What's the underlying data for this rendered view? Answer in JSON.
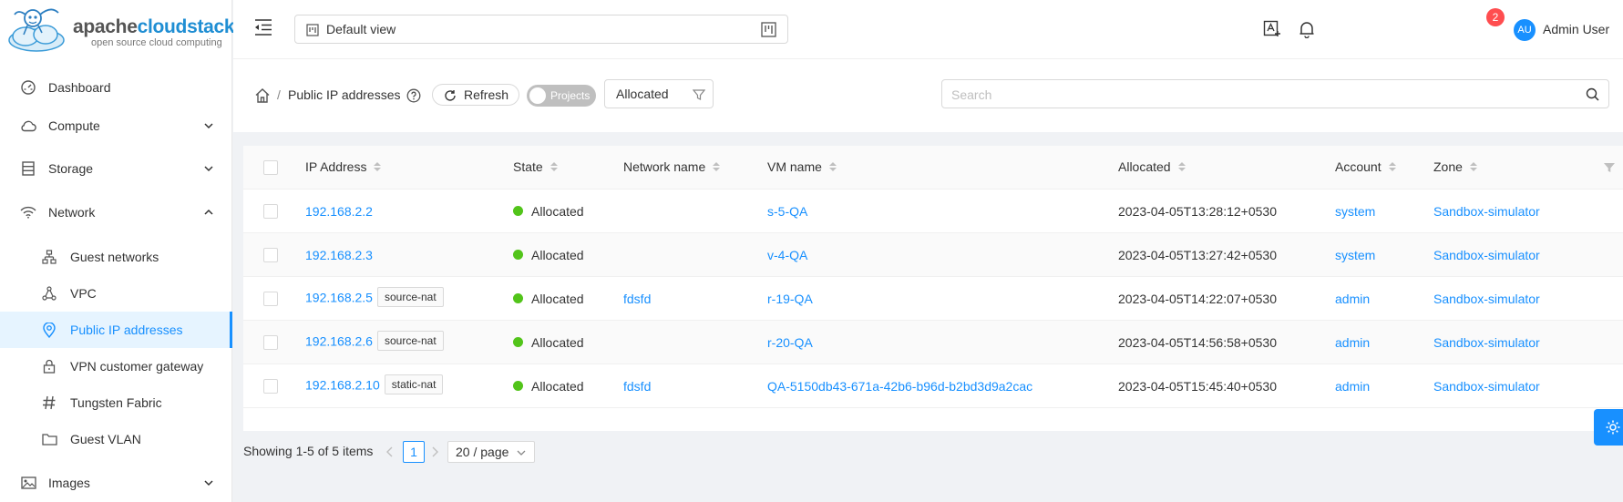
{
  "brand": {
    "name_prefix": "apache",
    "name_suffix": "cloudstack",
    "tagline": "open source cloud computing"
  },
  "sidebar": {
    "items": [
      {
        "label": "Dashboard",
        "icon": "dashboard-icon"
      },
      {
        "label": "Compute",
        "icon": "cloud-icon",
        "expanded": false
      },
      {
        "label": "Storage",
        "icon": "storage-icon",
        "expanded": false
      },
      {
        "label": "Network",
        "icon": "wifi-icon",
        "expanded": true
      },
      {
        "label": "Images",
        "icon": "picture-icon",
        "expanded": false
      }
    ],
    "network_subitems": [
      {
        "label": "Guest networks",
        "icon": "cluster-icon"
      },
      {
        "label": "VPC",
        "icon": "deployment-unit-icon"
      },
      {
        "label": "Public IP addresses",
        "icon": "environment-icon",
        "active": true
      },
      {
        "label": "VPN customer gateway",
        "icon": "lock-icon"
      },
      {
        "label": "Tungsten Fabric",
        "icon": "hashtag-icon"
      },
      {
        "label": "Guest VLAN",
        "icon": "folder-icon"
      }
    ]
  },
  "header": {
    "view_selector": "Default view",
    "notification_count": "2",
    "avatar_initials": "AU",
    "user_name": "Admin User"
  },
  "toolbar": {
    "breadcrumb_separator": "/",
    "page_title": "Public IP addresses",
    "refresh_label": "Refresh",
    "projects_toggle_label": "Projects",
    "filter_value": "Allocated",
    "search_placeholder": "Search"
  },
  "table": {
    "columns": [
      "IP Address",
      "State",
      "Network name",
      "VM name",
      "Allocated",
      "Account",
      "Zone"
    ],
    "rows": [
      {
        "ip": "192.168.2.2",
        "tag": "",
        "state": "Allocated",
        "network": "",
        "vm": "s-5-QA",
        "allocated": "2023-04-05T13:28:12+0530",
        "account": "system",
        "zone": "Sandbox-simulator"
      },
      {
        "ip": "192.168.2.3",
        "tag": "",
        "state": "Allocated",
        "network": "",
        "vm": "v-4-QA",
        "allocated": "2023-04-05T13:27:42+0530",
        "account": "system",
        "zone": "Sandbox-simulator"
      },
      {
        "ip": "192.168.2.5",
        "tag": "source-nat",
        "state": "Allocated",
        "network": "fdsfd",
        "vm": "r-19-QA",
        "allocated": "2023-04-05T14:22:07+0530",
        "account": "admin",
        "zone": "Sandbox-simulator"
      },
      {
        "ip": "192.168.2.6",
        "tag": "source-nat",
        "state": "Allocated",
        "network": "",
        "vm": "r-20-QA",
        "allocated": "2023-04-05T14:56:58+0530",
        "account": "admin",
        "zone": "Sandbox-simulator"
      },
      {
        "ip": "192.168.2.10",
        "tag": "static-nat",
        "state": "Allocated",
        "network": "fdsfd",
        "vm": "QA-5150db43-671a-42b6-b96d-b2bd3d9a2cac",
        "allocated": "2023-04-05T15:45:40+0530",
        "account": "admin",
        "zone": "Sandbox-simulator"
      }
    ]
  },
  "pagination": {
    "summary": "Showing 1-5 of 5 items",
    "current_page": "1",
    "page_size": "20 / page"
  },
  "colors": {
    "accent": "#1890ff",
    "status_allocated": "#52c41a",
    "badge": "#ff4d4f"
  }
}
